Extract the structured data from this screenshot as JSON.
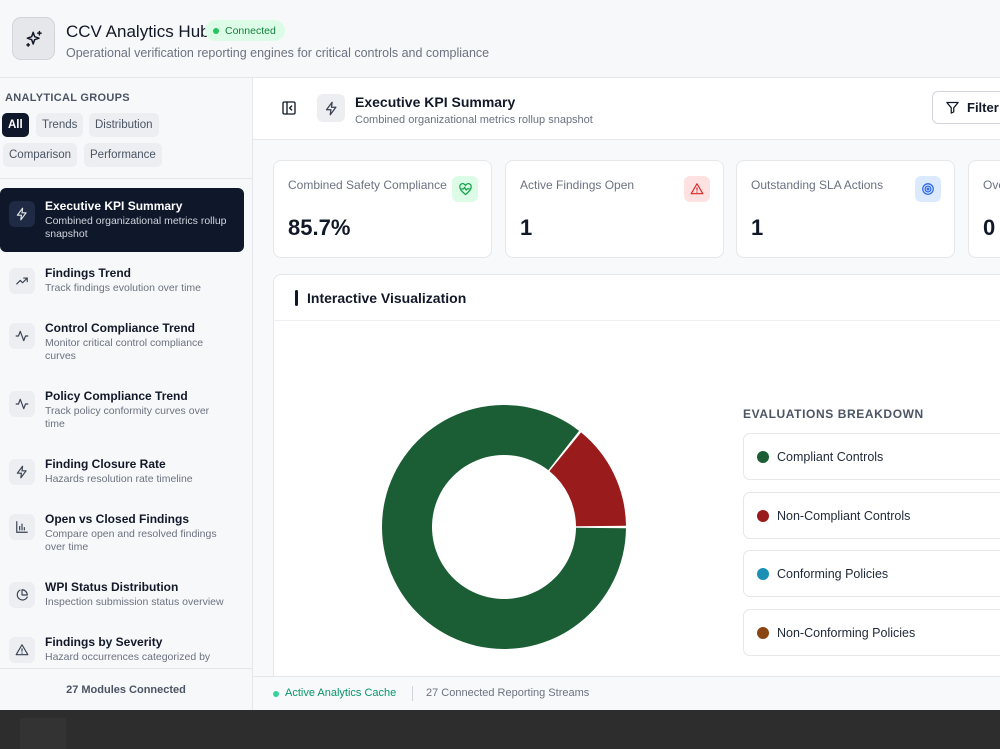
{
  "header": {
    "title": "CCV Analytics Hub",
    "status": "Connected",
    "subtitle": "Operational verification reporting engines for critical controls and compliance"
  },
  "sidebar": {
    "groups_label": "ANALYTICAL GROUPS",
    "filters": [
      "All",
      "Trends",
      "Distribution",
      "Comparison",
      "Performance"
    ],
    "active_filter": "All",
    "items": [
      {
        "title": "Executive KPI Summary",
        "desc": "Combined organizational metrics rollup snapshot",
        "icon": "bolt-icon"
      },
      {
        "title": "Findings Trend",
        "desc": "Track findings evolution over time",
        "icon": "trending-up-icon"
      },
      {
        "title": "Control Compliance Trend",
        "desc": "Monitor critical control compliance curves",
        "icon": "activity-icon"
      },
      {
        "title": "Policy Compliance Trend",
        "desc": "Track policy conformity curves over time",
        "icon": "activity-icon"
      },
      {
        "title": "Finding Closure Rate",
        "desc": "Hazards resolution rate timeline",
        "icon": "bolt-icon"
      },
      {
        "title": "Open vs Closed Findings",
        "desc": "Compare open and resolved findings over time",
        "icon": "bar-chart-icon"
      },
      {
        "title": "WPI Status Distribution",
        "desc": "Inspection submission status overview",
        "icon": "pie-chart-icon"
      },
      {
        "title": "Findings by Severity",
        "desc": "Hazard occurrences categorized by",
        "icon": "warning-icon"
      }
    ],
    "footer": "27 Modules Connected"
  },
  "main": {
    "title": "Executive KPI Summary",
    "subtitle": "Combined organizational metrics rollup snapshot",
    "filter_label": "Filter",
    "kpis": [
      {
        "label": "Combined Safety Compliance",
        "value": "85.7%",
        "icon": "heart-pulse-icon",
        "color": "#16a34a"
      },
      {
        "label": "Active Findings Open",
        "value": "1",
        "icon": "warning-icon",
        "color": "#dc2626"
      },
      {
        "label": "Outstanding SLA Actions",
        "value": "1",
        "icon": "target-icon",
        "color": "#2563eb"
      },
      {
        "label": "Ove",
        "value": "0",
        "icon": "",
        "color": "#6b7280"
      }
    ],
    "viz_title": "Interactive Visualization",
    "breakdown_label": "EVALUATIONS BREAKDOWN",
    "legend": [
      {
        "label": "Compliant Controls",
        "color": "#1b5e35"
      },
      {
        "label": "Non-Compliant Controls",
        "color": "#991b1b"
      },
      {
        "label": "Conforming Policies",
        "color": "#1b90b5"
      },
      {
        "label": "Non-Conforming Policies",
        "color": "#8b4513"
      }
    ],
    "status_cache": "Active Analytics Cache",
    "status_streams": "27 Connected Reporting Streams"
  },
  "chart_data": {
    "type": "pie",
    "categories": [
      "Compliant Controls",
      "Non-Compliant Controls",
      "Conforming Policies",
      "Non-Conforming Policies"
    ],
    "values": [
      6,
      1,
      0,
      0
    ],
    "colors": [
      "#1b5e35",
      "#991b1b",
      "#1b90b5",
      "#8b4513"
    ],
    "title": ""
  }
}
